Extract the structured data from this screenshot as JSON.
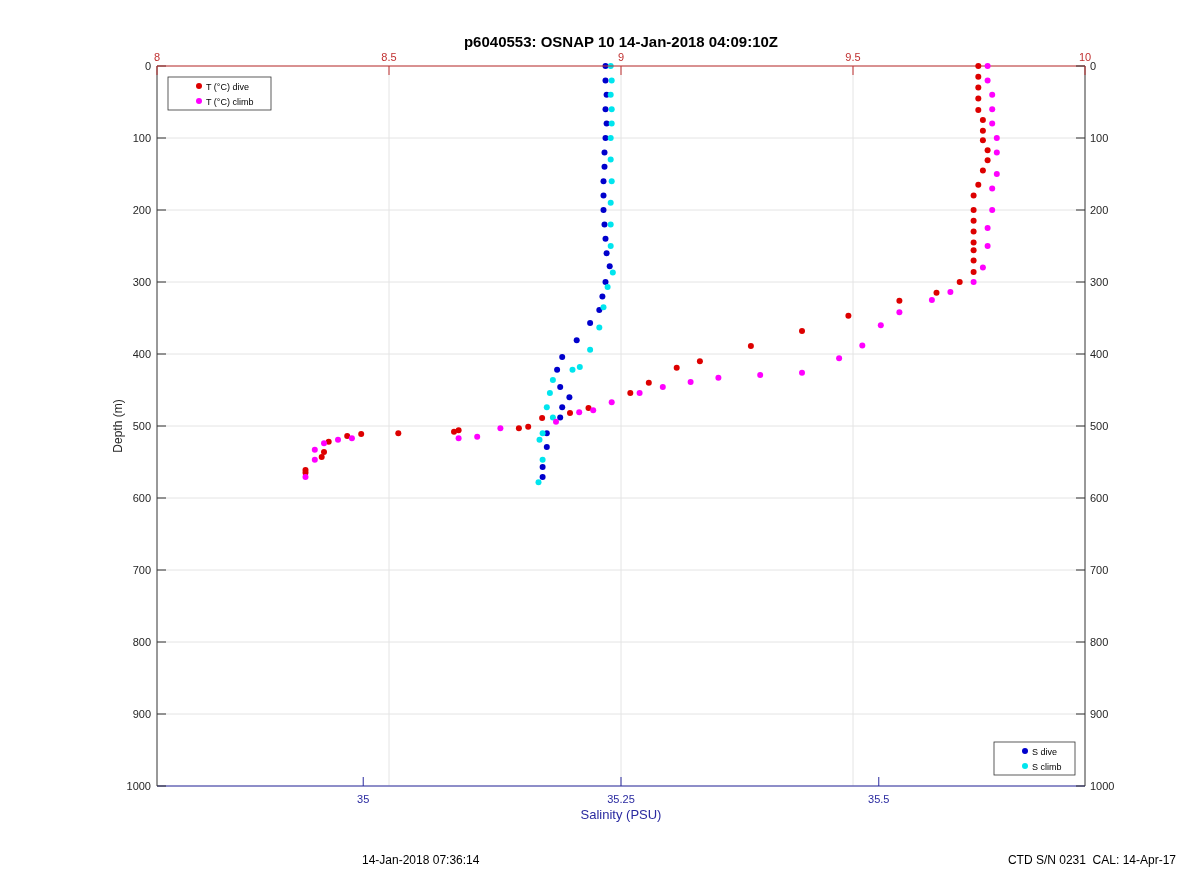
{
  "figure": {
    "salinity_axes": {
      "chart_data": {
        "type": "scatter",
        "title": "p6040553: OSNAP 10 14-Jan-2018 04:09:10Z",
        "xlabel": "Salinity (PSU)",
        "ylabel": "Depth (m)",
        "xlim": [
          34.8,
          35.7
        ],
        "ylim": [
          1000,
          0
        ],
        "xticks": [
          35,
          35.25,
          35.5
        ],
        "yticks": [
          0,
          100,
          200,
          300,
          400,
          500,
          600,
          700,
          800,
          900,
          1000
        ],
        "legend": "lower right",
        "series": [
          {
            "name": "S dive",
            "color": "#0000cc",
            "x": [
              35.235,
              35.235,
              35.236,
              35.235,
              35.236,
              35.235,
              35.234,
              35.234,
              35.233,
              35.233,
              35.233,
              35.234,
              35.235,
              35.236,
              35.239,
              35.235,
              35.232,
              35.229,
              35.22,
              35.207,
              35.193,
              35.188,
              35.191,
              35.2,
              35.193,
              35.191,
              35.178,
              35.178,
              35.174,
              35.174
            ],
            "values": [
              0,
              20,
              40,
              60,
              80,
              100,
              120,
              140,
              160,
              180,
              200,
              220,
              240,
              260,
              278,
              300,
              320,
              339,
              357,
              381,
              404,
              422,
              446,
              460,
              474,
              488,
              510,
              529,
              557,
              571
            ]
          },
          {
            "name": "S climb",
            "color": "#00e5ee",
            "x": [
              35.24,
              35.241,
              35.24,
              35.241,
              35.241,
              35.24,
              35.24,
              35.241,
              35.24,
              35.24,
              35.24,
              35.242,
              35.237,
              35.233,
              35.229,
              35.22,
              35.21,
              35.203,
              35.184,
              35.181,
              35.178,
              35.184,
              35.174,
              35.171,
              35.174,
              35.17
            ],
            "values": [
              0,
              20,
              40,
              60,
              80,
              100,
              130,
              160,
              190,
              220,
              250,
              287,
              307,
              335,
              363,
              394,
              418,
              422,
              436,
              454,
              474,
              488,
              510,
              519,
              547,
              578
            ]
          }
        ]
      }
    },
    "temperature_axes": {
      "chart_data": {
        "type": "scatter",
        "xlim": [
          8,
          10
        ],
        "ylim": [
          1000,
          0
        ],
        "xticks": [
          8,
          8.5,
          9,
          9.5,
          10
        ],
        "yticks": [
          0,
          100,
          200,
          300,
          400,
          500,
          600,
          700,
          800,
          900,
          1000
        ],
        "legend": "upper left",
        "series": [
          {
            "name": "T (°C) dive",
            "color": "#dd0000",
            "x": [
              9.77,
              9.77,
              9.77,
              9.77,
              9.77,
              9.78,
              9.78,
              9.78,
              9.79,
              9.79,
              9.78,
              9.77,
              9.76,
              9.76,
              9.76,
              9.76,
              9.76,
              9.76,
              9.76,
              9.76,
              9.73,
              9.68,
              9.6,
              9.49,
              9.39,
              9.28,
              9.17,
              9.12,
              9.06,
              9.02,
              8.93,
              8.89,
              8.83,
              8.8,
              8.78,
              8.65,
              8.64,
              8.52,
              8.44,
              8.41,
              8.37,
              8.36,
              8.355,
              8.32,
              8.32
            ],
            "values": [
              0,
              15,
              30,
              45,
              61,
              75,
              90,
              103,
              117,
              131,
              145,
              165,
              180,
              200,
              215,
              230,
              245,
              256,
              270,
              286,
              300,
              315,
              326,
              347,
              368,
              389,
              410,
              419,
              440,
              454,
              475,
              482,
              489,
              501,
              503,
              506,
              508,
              510,
              511,
              514,
              522,
              536,
              543,
              561,
              565
            ]
          },
          {
            "name": "T (°C) climb",
            "color": "#ff00ff",
            "x": [
              9.79,
              9.79,
              9.8,
              9.8,
              9.8,
              9.81,
              9.81,
              9.81,
              9.8,
              9.8,
              9.79,
              9.79,
              9.78,
              9.76,
              9.71,
              9.67,
              9.6,
              9.56,
              9.52,
              9.47,
              9.39,
              9.3,
              9.21,
              9.15,
              9.09,
              9.04,
              8.98,
              8.94,
              8.91,
              8.86,
              8.74,
              8.69,
              8.65,
              8.42,
              8.39,
              8.36,
              8.34,
              8.34,
              8.32
            ],
            "values": [
              0,
              20,
              40,
              60,
              80,
              100,
              120,
              150,
              170,
              200,
              225,
              250,
              280,
              300,
              314,
              325,
              342,
              360,
              388,
              406,
              426,
              429,
              433,
              439,
              446,
              454,
              467,
              478,
              481,
              494,
              503,
              515,
              517,
              517,
              519,
              524,
              533,
              547,
              571
            ]
          }
        ]
      }
    },
    "footer_left": "14-Jan-2018 07:36:14",
    "footer_right": "CTD S/N 0231  CAL: 14-Apr-17"
  }
}
